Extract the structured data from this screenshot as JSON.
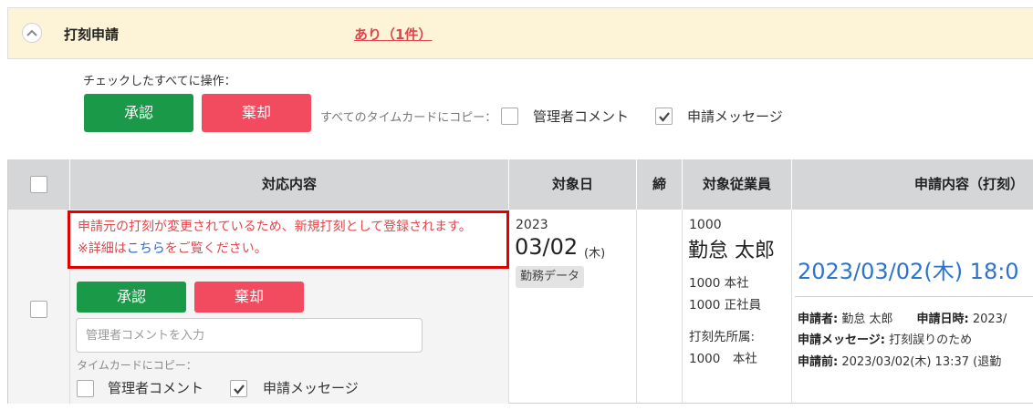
{
  "header": {
    "title": "打刻申請",
    "count_text": "あり（1件）"
  },
  "bulk": {
    "label": "チェックしたすべてに操作：",
    "approve": "承認",
    "reject": "棄却",
    "copy_label": "すべてのタイムカードにコピー：",
    "admin_comment": {
      "label": "管理者コメント",
      "checked": false
    },
    "request_message": {
      "label": "申請メッセージ",
      "checked": true
    }
  },
  "table": {
    "headers": [
      "対応内容",
      "対象日",
      "締",
      "対象従業員",
      "申請内容（打刻）"
    ]
  },
  "row": {
    "warning_line1": "申請元の打刻が変更されているため、新規打刻として登録されます。",
    "warning_line2_pre": "※詳細は",
    "warning_link": "こちら",
    "warning_line2_post": "をご覧ください。",
    "approve": "承認",
    "reject": "棄却",
    "comment_placeholder": "管理者コメントを入力",
    "copy_label": "タイムカードにコピー：",
    "admin_comment": {
      "label": "管理者コメント",
      "checked": false
    },
    "request_message": {
      "label": "申請メッセージ",
      "checked": true
    },
    "date_year": "2023",
    "date_md": "03/02",
    "date_weekday": "(木)",
    "date_tag": "勤務データ",
    "emp_code": "1000",
    "emp_name": "勤怠 太郎",
    "emp_dept": "1000 本社",
    "emp_type": "1000 正社員",
    "emp_punch_label": "打刻先所属:",
    "emp_punch_value": "1000　本社",
    "request_datetime": "2023/03/02(木) 18:0",
    "applicant_label": "申請者:",
    "applicant_value": "勤怠 太郎",
    "applied_at_label": "申請日時:",
    "applied_at_value": "2023/",
    "message_label": "申請メッセージ:",
    "message_value": "打刻誤りのため",
    "before_label": "申請前:",
    "before_value": "2023/03/02(木) 13:37 (退勤"
  }
}
